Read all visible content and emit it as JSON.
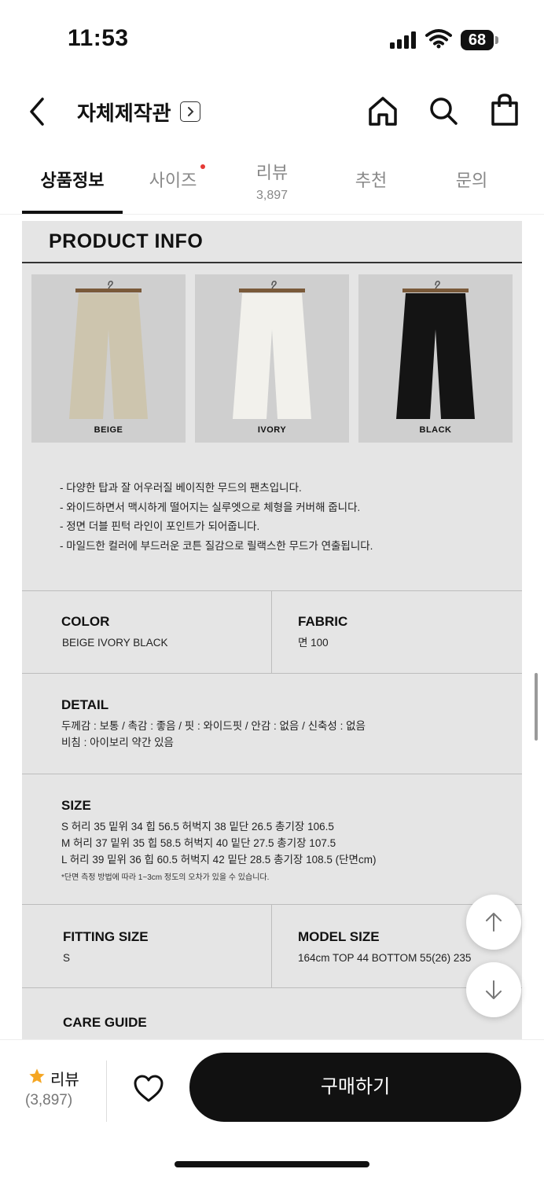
{
  "status_bar": {
    "time": "11:53",
    "battery": "68"
  },
  "header": {
    "store_name": "자체제작관"
  },
  "tabs": [
    {
      "label": "상품정보"
    },
    {
      "label": "사이즈"
    },
    {
      "label": "리뷰",
      "count": "3,897"
    },
    {
      "label": "추천"
    },
    {
      "label": "문의"
    }
  ],
  "product_info": {
    "title": "PRODUCT INFO",
    "colors": [
      {
        "caption": "BEIGE",
        "swatch": "#cdc5ae"
      },
      {
        "caption": "IVORY",
        "swatch": "#f2f1ec"
      },
      {
        "caption": "BLACK",
        "swatch": "#141414"
      }
    ],
    "description": [
      "- 다양한 탑과 잘 어우러질 베이직한 무드의 팬츠입니다.",
      "- 와이드하면서 맥시하게 떨어지는 실루엣으로 체형을 커버해 줍니다.",
      "- 정면 더블 핀턱 라인이 포인트가 되어줍니다.",
      "- 마일드한 컬러에 부드러운 코튼 질감으로 릴랙스한 무드가 연출됩니다."
    ],
    "color": {
      "heading": "COLOR",
      "value": "BEIGE    IVORY    BLACK"
    },
    "fabric": {
      "heading": "FABRIC",
      "value": "면 100"
    },
    "detail": {
      "heading": "DETAIL",
      "lines": [
        "두께감 : 보통 / 촉감 : 좋음 / 핏 : 와이드핏 / 안감 : 없음 / 신축성 : 없음",
        "비침 : 아이보리 약간 있음"
      ]
    },
    "size": {
      "heading": "SIZE",
      "lines": [
        "S 허리 35 밑위 34 힙 56.5 허벅지 38 밑단 26.5 총기장 106.5",
        "M 허리 37 밑위 35 힙 58.5 허벅지 40 밑단 27.5 총기장 107.5",
        "L 허리 39 밑위 36 힙 60.5 허벅지 42 밑단 28.5 총기장 108.5 (단면cm)"
      ],
      "note": "*단면 측정 방법에 따라 1~3cm 정도의 오차가 있을 수 있습니다."
    },
    "fitting_size": {
      "heading": "FITTING SIZE",
      "value": "S"
    },
    "model_size": {
      "heading": "MODEL SIZE",
      "value": "164cm   TOP 44   BOTTOM 55(26)   235"
    },
    "care_guide": {
      "heading": "CARE GUIDE"
    }
  },
  "bottom_bar": {
    "review_label": "리뷰",
    "review_count": "(3,897)",
    "buy_label": "구매하기"
  }
}
